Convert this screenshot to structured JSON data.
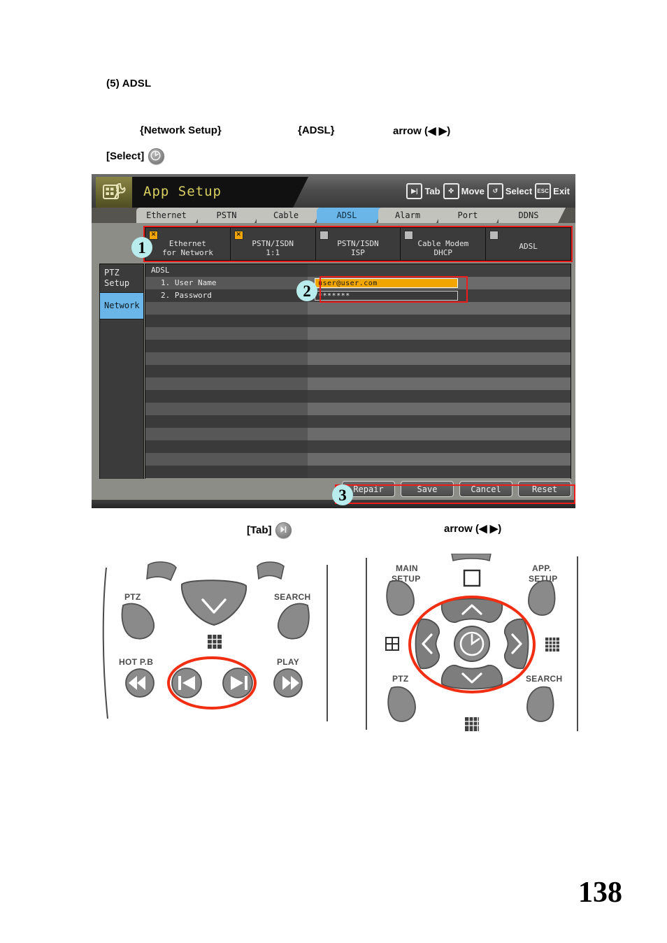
{
  "document": {
    "heading": "(5) ADSL",
    "step": {
      "network_setup": "{Network Setup}",
      "adsl": "{ADSL}",
      "arrow": "arrow (◀ ▶)"
    },
    "select_label": "[Select]",
    "caption": {
      "tab_label": "[Tab]",
      "arrow": "arrow (◀ ▶)"
    },
    "page_number": "138"
  },
  "dvr": {
    "title": "App Setup",
    "title_icon": "setup-wrench-icon",
    "hints": [
      {
        "icon": "tab-icon",
        "glyph": "▶|",
        "label": "Tab"
      },
      {
        "icon": "move-icon",
        "glyph": "✜",
        "label": "Move"
      },
      {
        "icon": "select-icon",
        "glyph": "↺",
        "label": "Select"
      },
      {
        "icon": "esc-icon",
        "glyph": "ESC",
        "label": "Exit"
      }
    ],
    "tabs": [
      {
        "label": "Ethernet",
        "active": false
      },
      {
        "label": "PSTN",
        "active": false
      },
      {
        "label": "Cable",
        "active": false
      },
      {
        "label": "ADSL",
        "active": true
      },
      {
        "label": "Alarm",
        "active": false
      },
      {
        "label": "Port",
        "active": false
      },
      {
        "label": "DDNS",
        "active": false
      }
    ],
    "options": [
      {
        "label_line1": "Ethernet",
        "label_line2": "for Network",
        "checked": true,
        "mark": "✕"
      },
      {
        "label_line1": "PSTN/ISDN",
        "label_line2": "1:1",
        "checked": true,
        "mark": "✕"
      },
      {
        "label_line1": "PSTN/ISDN",
        "label_line2": "ISP",
        "checked": false,
        "mark": ""
      },
      {
        "label_line1": "Cable Modem",
        "label_line2": "DHCP",
        "checked": false,
        "mark": ""
      },
      {
        "label_line1": "ADSL",
        "label_line2": "",
        "checked": false,
        "mark": ""
      }
    ],
    "sidebar": [
      {
        "label_line1": "PTZ",
        "label_line2": "Setup",
        "active": false
      },
      {
        "label_line1": "Network",
        "label_line2": "",
        "active": true
      }
    ],
    "section_title": "ADSL",
    "fields": [
      {
        "label": "1. User Name",
        "value": "user@user.com",
        "focused": true
      },
      {
        "label": "2. Password",
        "value": "*******",
        "focused": false
      }
    ],
    "buttons": [
      "Repair",
      "Save",
      "Cancel",
      "Reset"
    ],
    "callouts": [
      "1",
      "2",
      "3"
    ],
    "colors": {
      "accent_active_tab": "#6ab6e8",
      "field_focus": "#f0a500",
      "callout_bg": "#b9ecec",
      "highlight_box": "#ef1c1c",
      "title_text": "#d8cf60"
    }
  },
  "remote_left": {
    "labels": [
      "PTZ",
      "SEARCH",
      "HOT P.B",
      "PLAY"
    ],
    "highlight": "prev-next-buttons"
  },
  "remote_right": {
    "labels": [
      "MAIN\nSETUP",
      "APP.\nSETUP",
      "PTZ",
      "SEARCH"
    ],
    "label_main_l1": "MAIN",
    "label_main_l2": "SETUP",
    "label_app_l1": "APP.",
    "label_app_l2": "SETUP",
    "label_ptz": "PTZ",
    "label_search": "SEARCH",
    "highlight": "direction-pad"
  }
}
